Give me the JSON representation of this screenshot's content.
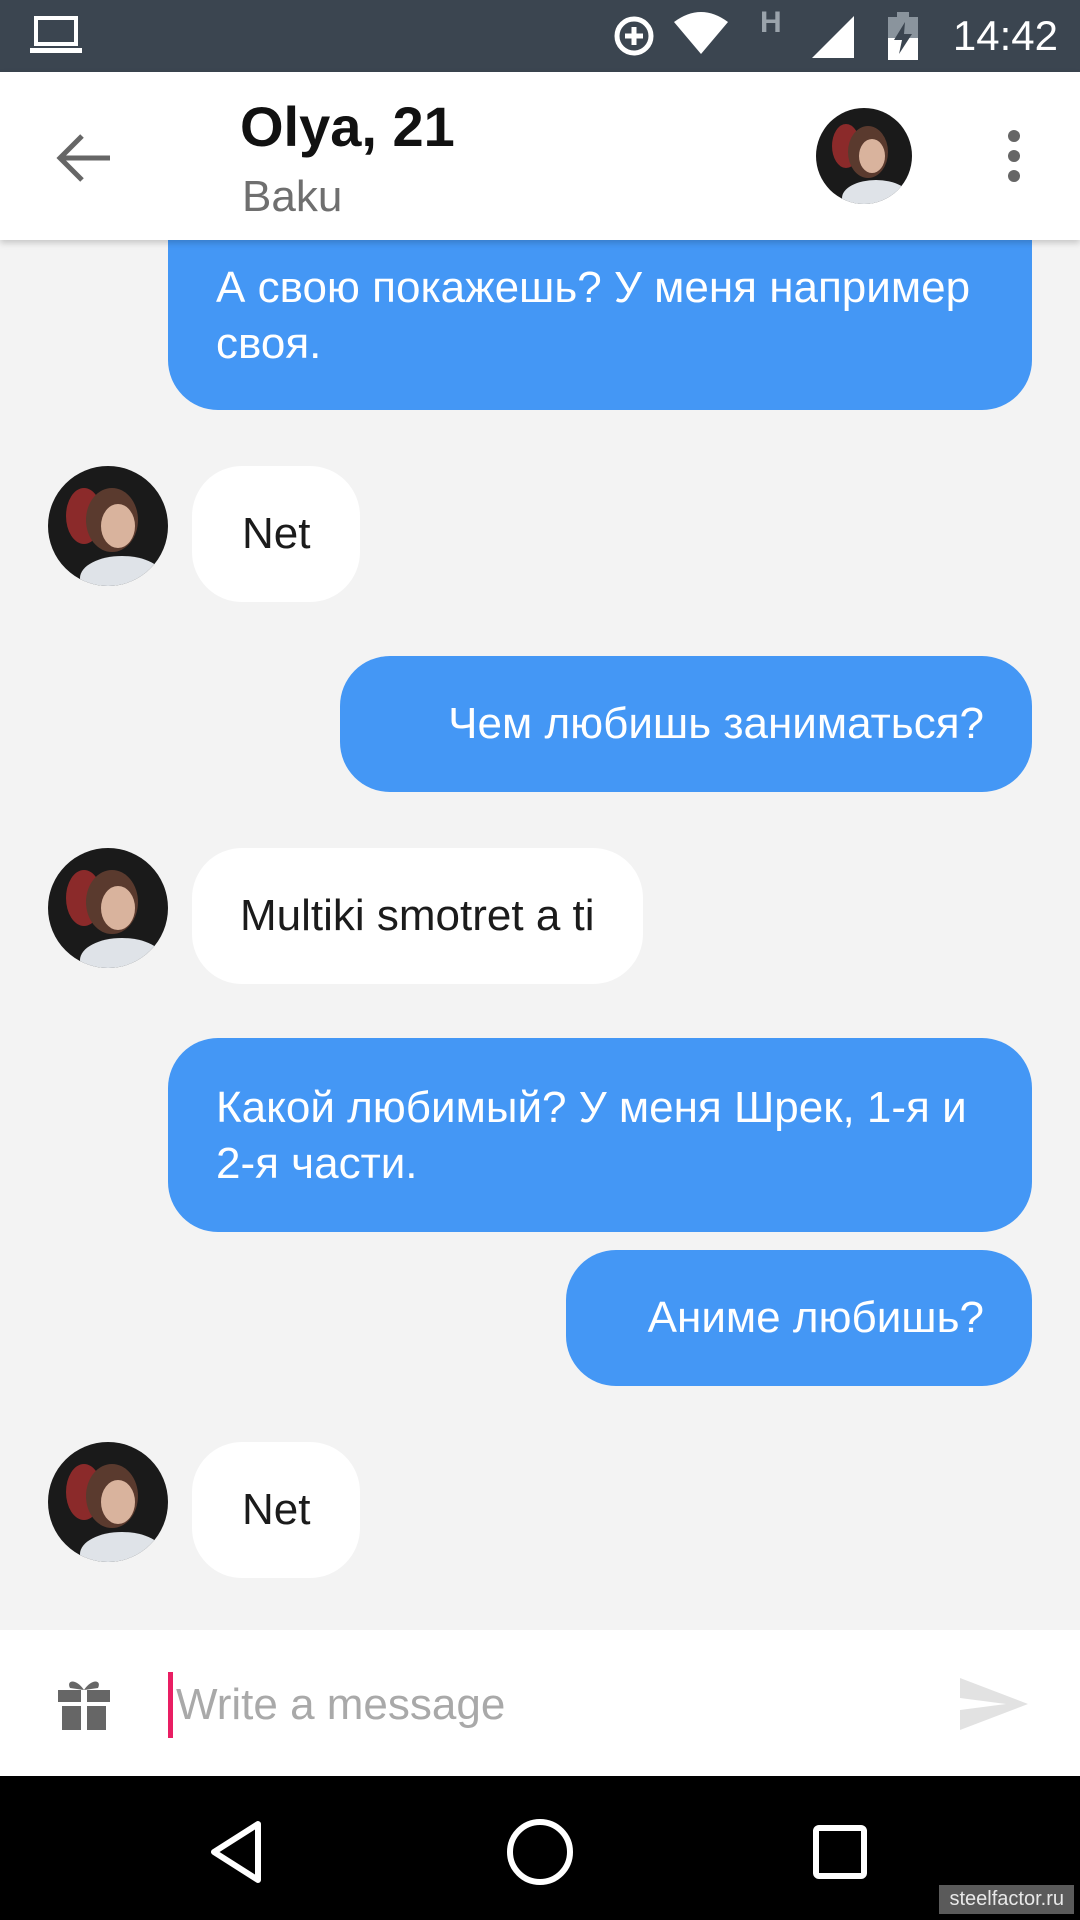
{
  "status_bar": {
    "time": "14:42",
    "network_label": "H",
    "icons": [
      "laptop-icon",
      "data-saver-icon",
      "wifi-icon",
      "cell-signal-icon",
      "battery-charging-icon"
    ]
  },
  "header": {
    "name": "Olya, 21",
    "city": "Baku",
    "back_icon": "arrow-back-icon",
    "menu_icon": "more-vert-icon"
  },
  "messages": [
    {
      "from": "me",
      "text": "А свою покажешь? У меня например своя."
    },
    {
      "from": "them",
      "text": "Net"
    },
    {
      "from": "me",
      "text": "Чем любишь заниматься?"
    },
    {
      "from": "them",
      "text": "Multiki smotret a ti"
    },
    {
      "from": "me",
      "text": "Какой любимый? У меня Шрек, 1-я и 2-я части."
    },
    {
      "from": "me",
      "text": "Аниме любишь?"
    },
    {
      "from": "them",
      "text": "Net"
    }
  ],
  "composer": {
    "placeholder": "Write a message",
    "value": "",
    "gift_icon": "gift-icon",
    "send_icon": "send-icon"
  },
  "navigation": {
    "icons": [
      "nav-back-icon",
      "nav-home-icon",
      "nav-recents-icon"
    ]
  },
  "watermark": "steelfactor.ru",
  "colors": {
    "outgoing_bubble": "#4497f5",
    "incoming_bubble": "#ffffff",
    "chat_background": "#f3f3f3",
    "status_bar": "#3b4550",
    "cursor": "#e91e63"
  }
}
